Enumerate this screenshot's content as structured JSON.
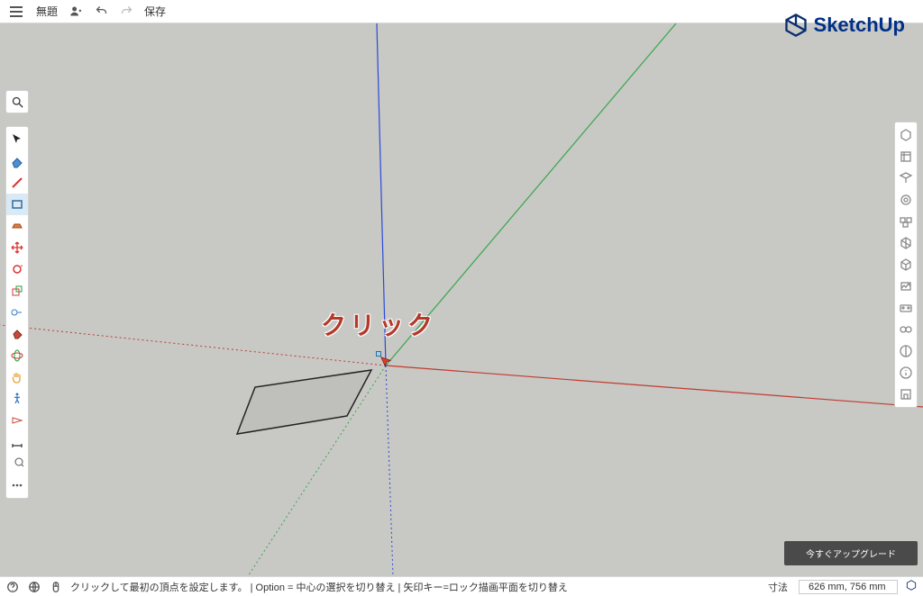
{
  "topbar": {
    "title": "無題",
    "save_label": "保存"
  },
  "brand": {
    "name": "SketchUp"
  },
  "annotation": {
    "text": "クリック"
  },
  "statusbar": {
    "hint": "クリックして最初の頂点を設定します。 | Option = 中心の選択を切り替え | 矢印キー=ロック描画平面を切り替え",
    "dims_label": "寸法",
    "dims_value": "626 mm, 756 mm"
  },
  "upgrade": {
    "label": "今すぐアップグレード"
  },
  "left_tools": [
    "select",
    "eraser",
    "pencil",
    "rectangle",
    "pushpull",
    "move",
    "rotate",
    "scale",
    "tape",
    "paint",
    "orbit",
    "pan",
    "walk",
    "section",
    "dimension",
    "text",
    "more"
  ],
  "right_panels": [
    "entity-info",
    "instructor",
    "outliner",
    "components",
    "materials",
    "styles",
    "tags",
    "scenes",
    "shadows",
    "fog",
    "softedges",
    "model-info",
    "3dwarehouse",
    "display"
  ],
  "colors": {
    "axis_red": "#c23b2e",
    "axis_green": "#35a84a",
    "axis_blue": "#2a4bd7",
    "annotation": "#b33a2b",
    "brand": "#0a2f6e"
  }
}
